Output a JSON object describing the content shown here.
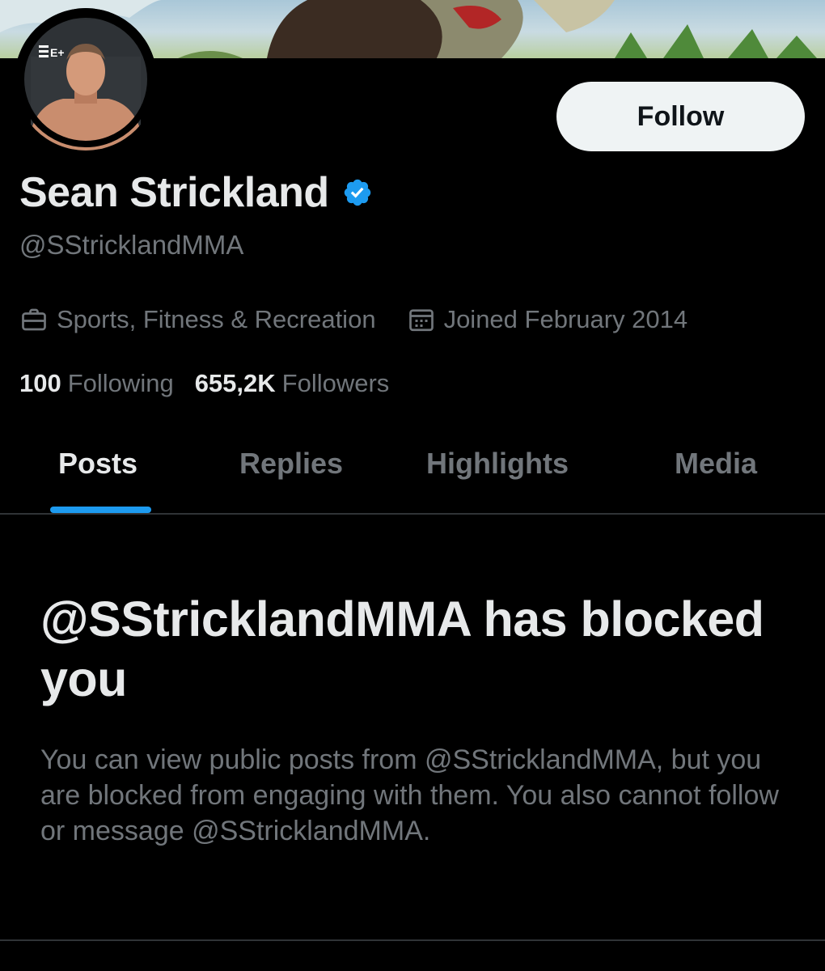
{
  "profile": {
    "display_name": "Sean Strickland",
    "handle": "@SStricklandMMA",
    "verified_icon": "verified-badge-icon",
    "follow_label": "Follow",
    "category": "Sports, Fitness & Recreation",
    "category_icon": "briefcase-icon",
    "joined": "Joined February 2014",
    "joined_icon": "calendar-icon",
    "following_count": "100",
    "following_label": "Following",
    "followers_count": "655,2K",
    "followers_label": "Followers",
    "avatar_logo_text": "E+"
  },
  "tabs": [
    {
      "label": "Posts",
      "active": true
    },
    {
      "label": "Replies",
      "active": false
    },
    {
      "label": "Highlights",
      "active": false
    },
    {
      "label": "Media",
      "active": false
    }
  ],
  "blocked": {
    "title": "@SStricklandMMA has blocked you",
    "message": "You can view public posts from @SStricklandMMA, but you are blocked from engaging with them. You also cannot follow or message @SStricklandMMA."
  },
  "colors": {
    "background": "#000000",
    "primary_text": "#e7e9ea",
    "secondary_text": "#71767b",
    "accent": "#1d9bf0",
    "follow_button_bg": "#eff3f4",
    "divider": "#2f3336"
  }
}
